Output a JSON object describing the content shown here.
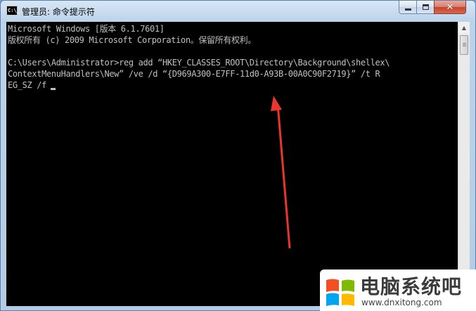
{
  "window": {
    "title": "管理员: 命令提示符",
    "icon_text": "C:\\_"
  },
  "console": {
    "lines": [
      "Microsoft Windows [版本 6.1.7601]",
      "版权所有 (c) 2009 Microsoft Corporation。保留所有权利。",
      "C:\\Users\\Administrator>reg add “HKEY_CLASSES_ROOT\\Directory\\Background\\shellex\\",
      "ContextMenuHandlers\\New” /ve /d “{D969A300-E7FF-11d0-A93B-00A0C90F2719}” /t R",
      "EG_SZ /f"
    ]
  },
  "watermark": {
    "title": "电脑系统吧",
    "url": "www.dnxitong.com"
  },
  "colors": {
    "console_bg": "#000000",
    "console_text": "#c0c0c0",
    "annotation_arrow": "#e8362c"
  },
  "icons": {
    "app": "cmd-icon",
    "minimize": "minimize-icon",
    "maximize": "maximize-icon",
    "close": "close-icon",
    "logo": "windows-logo-icon"
  }
}
